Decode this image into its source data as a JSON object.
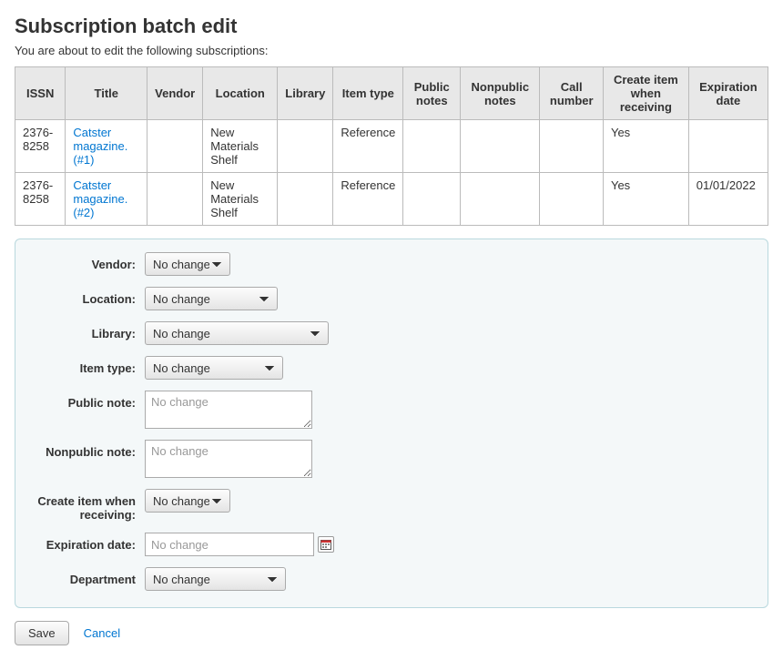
{
  "page": {
    "title": "Subscription batch edit",
    "intro": "You are about to edit the following subscriptions:"
  },
  "table": {
    "headers": {
      "issn": "ISSN",
      "title": "Title",
      "vendor": "Vendor",
      "location": "Location",
      "library": "Library",
      "item_type": "Item type",
      "public_notes": "Public notes",
      "nonpublic_notes": "Nonpublic notes",
      "call_number": "Call number",
      "create_item": "Create item when receiving",
      "expiration": "Expiration date"
    },
    "rows": [
      {
        "issn": "2376-8258",
        "title": "Catster magazine. (#1)",
        "vendor": "",
        "location": "New Materials Shelf",
        "library": "",
        "item_type": "Reference",
        "public_notes": "",
        "nonpublic_notes": "",
        "call_number": "",
        "create_item": "Yes",
        "expiration": ""
      },
      {
        "issn": "2376-8258",
        "title": "Catster magazine. (#2)",
        "vendor": "",
        "location": "New Materials Shelf",
        "library": "",
        "item_type": "Reference",
        "public_notes": "",
        "nonpublic_notes": "",
        "call_number": "",
        "create_item": "Yes",
        "expiration": "01/01/2022"
      }
    ]
  },
  "form": {
    "labels": {
      "vendor": "Vendor:",
      "location": "Location:",
      "library": "Library:",
      "item_type": "Item type:",
      "public_note": "Public note:",
      "nonpublic_note": "Nonpublic note:",
      "create_item": "Create item when receiving:",
      "expiration_date": "Expiration date:",
      "department": "Department"
    },
    "options": {
      "no_change": "No change"
    },
    "placeholders": {
      "public_note": "No change",
      "nonpublic_note": "No change",
      "expiration_date": "No change"
    }
  },
  "actions": {
    "save": "Save",
    "cancel": "Cancel"
  }
}
